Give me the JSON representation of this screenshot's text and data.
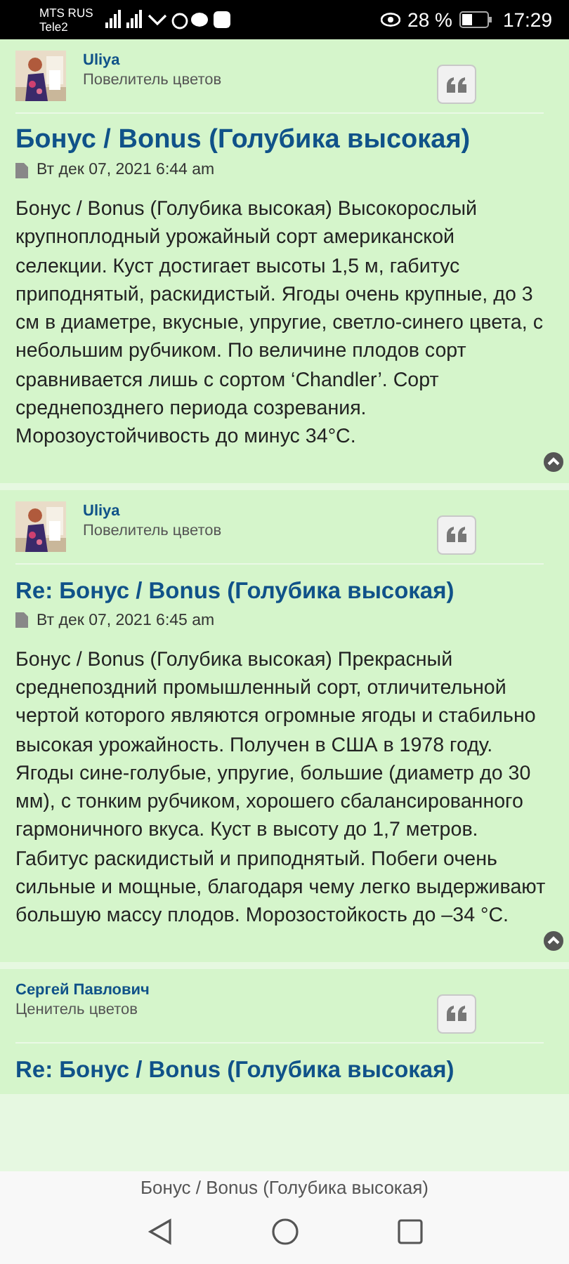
{
  "status_bar": {
    "carrier_1": "MTS RUS",
    "carrier_2": "Tele2",
    "battery_percent": "28 %",
    "time": "17:29"
  },
  "posts": [
    {
      "author": "Uliya",
      "rank": "Повелитель цветов",
      "has_avatar": true,
      "title": "Бонус / Bonus (Голубика высокая)",
      "title_large": true,
      "date": "Вт дек 07, 2021 6:44 am",
      "body": "Бонус / Bonus (Голубика высокая) Высокорослый крупноплодный урожайный сорт американской селекции. Куст достигает высоты 1,5 м, габитус приподнятый, раскидистый. Ягоды очень крупные, до 3 см в диаметре, вкусные, упругие, светло-синего цвета, с небольшим рубчиком. По величине плодов сорт сравнивается лишь с сортом ‘Chandler’. Сорт среднепозднего периода созревания. Морозоустойчивость до минус 34°С."
    },
    {
      "author": "Uliya",
      "rank": "Повелитель цветов",
      "has_avatar": true,
      "title": "Re: Бонус / Bonus (Голубика высокая)",
      "title_large": false,
      "date": "Вт дек 07, 2021 6:45 am",
      "body": "Бонус / Bonus (Голубика высокая) Прекрасный среднепоздний промышленный сорт, отличительной чертой которого являются огромные ягоды и стабильно высокая урожайность. Получен в США в 1978 году. Ягоды сине-голубые, упругие, большие (диаметр до 30 мм), с тонким рубчиком, хорошего сбалансированного гармоничного вкуса. Куст в высоту до 1,7 метров. Габитус раскидистый и приподнятый. Побеги очень сильные и мощные, благодаря чему легко выдерживают большую массу плодов. Морозостойкость до –34 °С."
    },
    {
      "author": "Сергей Павлович",
      "rank": "Ценитель цветов",
      "has_avatar": false,
      "title": "Re: Бонус / Bonus (Голубика высокая)",
      "title_large": false
    }
  ],
  "page_title": "Бонус / Bonus (Голубика высокая)"
}
